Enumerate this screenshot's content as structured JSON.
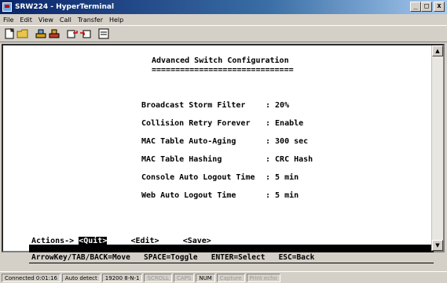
{
  "window": {
    "title": "SRW224 - HyperTerminal"
  },
  "menu": [
    "File",
    "Edit",
    "View",
    "Call",
    "Transfer",
    "Help"
  ],
  "toolbar_icons": [
    "new-icon",
    "open-icon",
    "call-icon",
    "disconnect-icon",
    "send-icon",
    "receive-icon",
    "properties-icon"
  ],
  "screen": {
    "heading": "Advanced Switch Configuration",
    "heading_underline": "==============================",
    "rows": [
      {
        "label": "Broadcast Storm Filter",
        "value": ": 20%"
      },
      {
        "label": "Collision Retry Forever",
        "value": ": Enable"
      },
      {
        "label": "MAC Table Auto-Aging",
        "value": ": 300 sec"
      },
      {
        "label": "MAC Table Hashing",
        "value": ": CRC Hash"
      },
      {
        "label": "Console Auto Logout Time",
        "value": ": 5 min"
      },
      {
        "label": "Web Auto Logout Time",
        "value": ": 5 min"
      }
    ],
    "actions_label": "Actions->",
    "actions": [
      "<Quit>",
      "<Edit>",
      "<Save>"
    ],
    "help": "ArrowKey/TAB/BACK=Move   SPACE=Toggle   ENTER=Select   ESC=Back"
  },
  "status": {
    "connected": "Connected 0:01:16",
    "detect": "Auto detect",
    "port": "19200 8-N-1",
    "scroll": "SCROLL",
    "caps": "CAPS",
    "num": "NUM",
    "capture": "Capture",
    "print": "Print echo"
  }
}
